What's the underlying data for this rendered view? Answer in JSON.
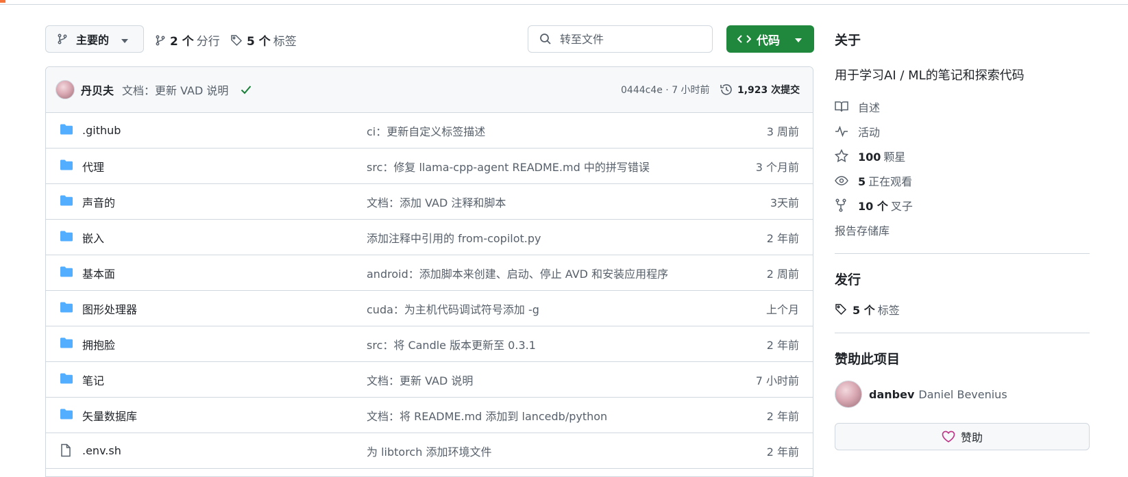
{
  "colors": {
    "accent_green": "#1f883d",
    "folder_blue": "#54aeff",
    "muted": "#57606a",
    "border": "#d0d7de",
    "heart": "#bf3989"
  },
  "toolbar": {
    "branch_label": "主要的",
    "branches_count": "2 个",
    "branches_label": "分行",
    "tags_count": "5 个",
    "tags_label": "标签",
    "goto_placeholder": "转至文件",
    "code_label": "代码"
  },
  "commit": {
    "author": "丹贝夫",
    "message": "文档：更新 VAD 说明",
    "sha_time": "0444c4e · 7 小时前",
    "count": "1,923 次提交"
  },
  "files": [
    {
      "type": "folder",
      "name": ".github",
      "message": "ci：更新自定义标签描述",
      "date": "3 周前"
    },
    {
      "type": "folder",
      "name": "代理",
      "message": "src：修复 llama-cpp-agent README.md 中的拼写错误",
      "date": "3 个月前"
    },
    {
      "type": "folder",
      "name": "声音的",
      "message": "文档：添加 VAD 注释和脚本",
      "date": "3天前"
    },
    {
      "type": "folder",
      "name": "嵌入",
      "message": "添加注释中引用的 from-copilot.py",
      "date": "2 年前"
    },
    {
      "type": "folder",
      "name": "基本面",
      "message": "android：添加脚本来创建、启动、停止 AVD 和安装应用程序",
      "date": "2 周前"
    },
    {
      "type": "folder",
      "name": "图形处理器",
      "message": "cuda：为主机代码调试符号添加 -g",
      "date": "上个月"
    },
    {
      "type": "folder",
      "name": "拥抱脸",
      "message": "src：将 Candle 版本更新至 0.3.1",
      "date": "2 年前"
    },
    {
      "type": "folder",
      "name": "笔记",
      "message": "文档：更新 VAD 说明",
      "date": "7 小时前"
    },
    {
      "type": "folder",
      "name": "矢量数据库",
      "message": "文档：将 README.md 添加到 lancedb/python",
      "date": "2 年前"
    },
    {
      "type": "file",
      "name": ".env.sh",
      "message": "为 libtorch 添加环境文件",
      "date": "2 年前"
    }
  ],
  "sidebar": {
    "about_title": "关于",
    "description": "用于学习AI / ML的笔记和探索代码",
    "readme": "自述",
    "activity": "活动",
    "stars_count": "100",
    "stars_label": "颗星",
    "watching_count": "5",
    "watching_label": "正在观看",
    "forks_count": "10 个",
    "forks_label": "叉子",
    "report": "报告存储库",
    "releases_title": "发行",
    "releases_tags_count": "5 个",
    "releases_tags_label": "标签",
    "sponsor_title": "赞助此项目",
    "sponsor_login": "danbev",
    "sponsor_name": "Daniel Bevenius",
    "sponsor_button": "赞助"
  }
}
